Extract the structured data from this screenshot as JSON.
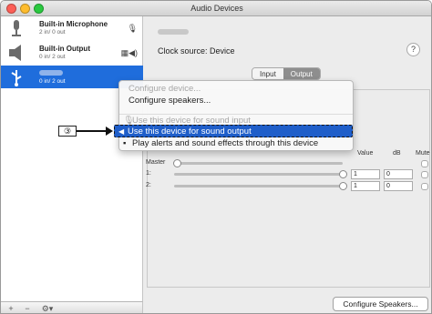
{
  "window": {
    "title": "Audio Devices"
  },
  "devices": [
    {
      "name": "Built-in Microphone",
      "io": "2 in/ 0 out",
      "icon": "microphone-icon"
    },
    {
      "name": "Built-in Output",
      "io": "0 in/ 2 out",
      "icon": "speaker-icon"
    },
    {
      "name": "",
      "io": "0 in/ 2 out",
      "icon": "usb-icon",
      "selected": true
    }
  ],
  "sidebar_footer": {
    "add": "+",
    "remove": "−",
    "gear": "⚙▾"
  },
  "main": {
    "clock_source": "Clock source:  Device",
    "help": "?",
    "tabs": [
      {
        "label": "Input"
      },
      {
        "label": "Output",
        "active": true
      }
    ],
    "format_select_value": "÷",
    "columns": {
      "value": "Value",
      "db": "dB",
      "mute": "Mute"
    },
    "channels": [
      {
        "label": "Master",
        "value": "",
        "db": ""
      },
      {
        "label": "1:",
        "value": "1",
        "db": "0"
      },
      {
        "label": "2:",
        "value": "1",
        "db": "0"
      }
    ],
    "configure_speakers_button": "Configure Speakers..."
  },
  "context_menu": {
    "items": [
      {
        "label": "Configure device...",
        "disabled": true
      },
      {
        "label": "Configure speakers...",
        "disabled": false
      },
      {
        "label": "Use this device for sound input",
        "disabled": true
      },
      {
        "label": "Use this device for sound output",
        "highlighted": true
      },
      {
        "label": "Play alerts and sound effects through this device",
        "disabled": false
      }
    ]
  },
  "callout": {
    "label": "③"
  },
  "colors": {
    "selection": "#1f6ddc",
    "menu_highlight": "#1f5ec9"
  }
}
